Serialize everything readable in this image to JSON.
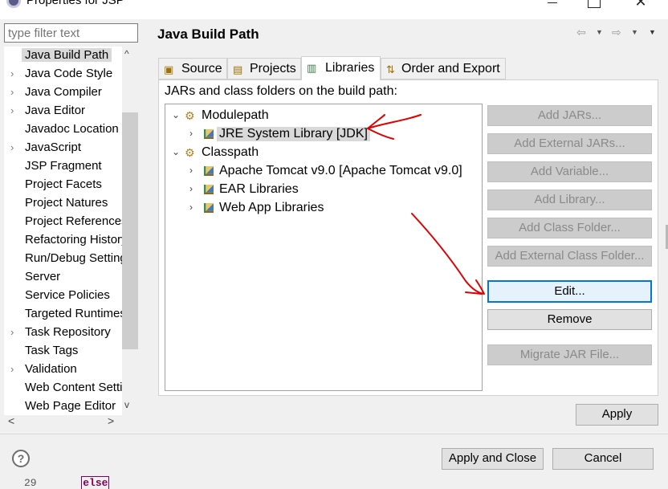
{
  "window": {
    "title": "Properties for JSP",
    "minimize_glyph": "—",
    "close_glyph": "✕"
  },
  "filter": {
    "placeholder": "type filter text",
    "value": ""
  },
  "left_tree": {
    "items": [
      {
        "label": "Java Build Path",
        "expandable": false,
        "selected": true
      },
      {
        "label": "Java Code Style",
        "expandable": true
      },
      {
        "label": "Java Compiler",
        "expandable": true
      },
      {
        "label": "Java Editor",
        "expandable": true
      },
      {
        "label": "Javadoc Location",
        "expandable": false
      },
      {
        "label": "JavaScript",
        "expandable": true
      },
      {
        "label": "JSP Fragment",
        "expandable": false
      },
      {
        "label": "Project Facets",
        "expandable": false
      },
      {
        "label": "Project Natures",
        "expandable": false
      },
      {
        "label": "Project References",
        "expandable": false
      },
      {
        "label": "Refactoring History",
        "expandable": false
      },
      {
        "label": "Run/Debug Settings",
        "expandable": false
      },
      {
        "label": "Server",
        "expandable": false
      },
      {
        "label": "Service Policies",
        "expandable": false
      },
      {
        "label": "Targeted Runtimes",
        "expandable": false
      },
      {
        "label": "Task Repository",
        "expandable": true
      },
      {
        "label": "Task Tags",
        "expandable": false
      },
      {
        "label": "Validation",
        "expandable": true
      },
      {
        "label": "Web Content Settings",
        "expandable": false
      },
      {
        "label": "Web Page Editor",
        "expandable": false
      }
    ],
    "scroll_up": "^",
    "scroll_down": "v",
    "scroll_left": "<",
    "scroll_right": ">"
  },
  "section": {
    "title": "Java Build Path"
  },
  "nav": {
    "back_glyph": "⇦",
    "forward_glyph": "⇨",
    "dropdown_glyph": "▼"
  },
  "tabs": [
    {
      "label": "Source",
      "icon": "source-folder-icon",
      "active": false
    },
    {
      "label": "Projects",
      "icon": "projects-icon",
      "active": false
    },
    {
      "label": "Libraries",
      "icon": "libraries-icon",
      "active": true
    },
    {
      "label": "Order and Export",
      "icon": "order-export-icon",
      "active": false
    }
  ],
  "libraries": {
    "heading": "JARs and class folders on the build path:",
    "tree": [
      {
        "label": "Modulepath",
        "level": 0,
        "expanded": true,
        "icon": "modulepath-icon"
      },
      {
        "label": "JRE System Library [JDK]",
        "level": 1,
        "expanded": false,
        "icon": "library-icon",
        "selected": true
      },
      {
        "label": "Classpath",
        "level": 0,
        "expanded": true,
        "icon": "classpath-icon"
      },
      {
        "label": "Apache Tomcat v9.0 [Apache Tomcat v9.0]",
        "level": 1,
        "expanded": false,
        "icon": "library-icon"
      },
      {
        "label": "EAR Libraries",
        "level": 1,
        "expanded": false,
        "icon": "library-icon"
      },
      {
        "label": "Web App Libraries",
        "level": 1,
        "expanded": false,
        "icon": "library-icon"
      }
    ],
    "expanded_glyph": "⌄",
    "collapsed_glyph": "›"
  },
  "buttons": {
    "add_jars": "Add JARs...",
    "add_external_jars": "Add External JARs...",
    "add_variable": "Add Variable...",
    "add_library": "Add Library...",
    "add_class_folder": "Add Class Folder...",
    "add_external_class_folder": "Add External Class Folder...",
    "edit": "Edit...",
    "remove": "Remove",
    "migrate_jar": "Migrate JAR File...",
    "apply": "Apply",
    "apply_and_close": "Apply and Close",
    "cancel": "Cancel"
  },
  "help": {
    "glyph": "?"
  },
  "editor_peek": {
    "line_number": "29",
    "keyword": "else"
  },
  "annotation_color": "#e00000"
}
